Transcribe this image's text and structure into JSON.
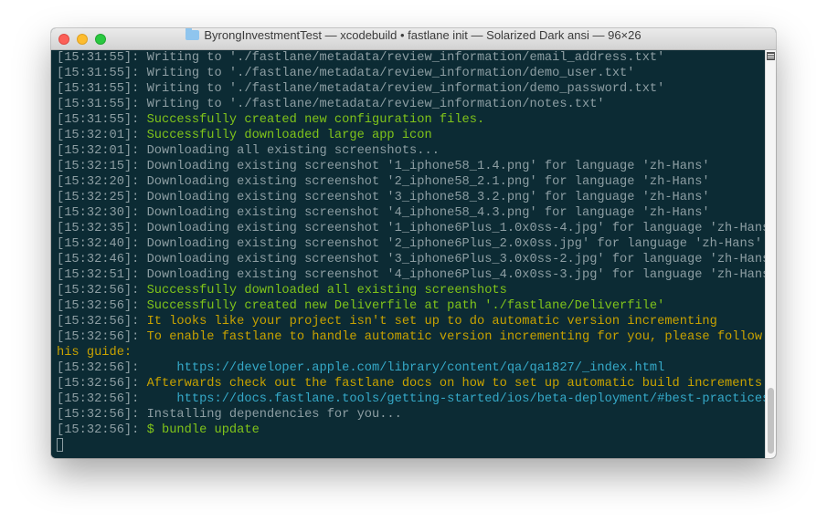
{
  "window": {
    "title": "ByrongInvestmentTest — xcodebuild • fastlane init — Solarized Dark ansi — 96×26",
    "folder_icon": "folder-icon"
  },
  "colors": {
    "background": "#0c2b34",
    "timestamp": "#8d9ea3",
    "green": "#80c41a",
    "yellow": "#c8a200",
    "cyan": "#35a9c8"
  },
  "terminal": {
    "lines": [
      {
        "ts": "[15:31:55]: ",
        "msg": "Writing to './fastlane/metadata/review_information/email_address.txt'",
        "color": "dim"
      },
      {
        "ts": "[15:31:55]: ",
        "msg": "Writing to './fastlane/metadata/review_information/demo_user.txt'",
        "color": "dim"
      },
      {
        "ts": "[15:31:55]: ",
        "msg": "Writing to './fastlane/metadata/review_information/demo_password.txt'",
        "color": "dim"
      },
      {
        "ts": "[15:31:55]: ",
        "msg": "Writing to './fastlane/metadata/review_information/notes.txt'",
        "color": "dim"
      },
      {
        "ts": "[15:31:55]: ",
        "msg": "Successfully created new configuration files.",
        "color": "green"
      },
      {
        "ts": "[15:32:01]: ",
        "msg": "Successfully downloaded large app icon",
        "color": "green"
      },
      {
        "ts": "[15:32:01]: ",
        "msg": "Downloading all existing screenshots...",
        "color": "dim"
      },
      {
        "ts": "[15:32:15]: ",
        "msg": "Downloading existing screenshot '1_iphone58_1.4.png' for language 'zh-Hans'",
        "color": "dim"
      },
      {
        "ts": "[15:32:20]: ",
        "msg": "Downloading existing screenshot '2_iphone58_2.1.png' for language 'zh-Hans'",
        "color": "dim"
      },
      {
        "ts": "[15:32:25]: ",
        "msg": "Downloading existing screenshot '3_iphone58_3.2.png' for language 'zh-Hans'",
        "color": "dim"
      },
      {
        "ts": "[15:32:30]: ",
        "msg": "Downloading existing screenshot '4_iphone58_4.3.png' for language 'zh-Hans'",
        "color": "dim"
      },
      {
        "ts": "[15:32:35]: ",
        "msg": "Downloading existing screenshot '1_iphone6Plus_1.0x0ss-4.jpg' for language 'zh-Hans'",
        "color": "dim"
      },
      {
        "ts": "[15:32:40]: ",
        "msg": "Downloading existing screenshot '2_iphone6Plus_2.0x0ss.jpg' for language 'zh-Hans'",
        "color": "dim"
      },
      {
        "ts": "[15:32:46]: ",
        "msg": "Downloading existing screenshot '3_iphone6Plus_3.0x0ss-2.jpg' for language 'zh-Hans'",
        "color": "dim"
      },
      {
        "ts": "[15:32:51]: ",
        "msg": "Downloading existing screenshot '4_iphone6Plus_4.0x0ss-3.jpg' for language 'zh-Hans'",
        "color": "dim"
      },
      {
        "ts": "[15:32:56]: ",
        "msg": "Successfully downloaded all existing screenshots",
        "color": "green"
      },
      {
        "ts": "[15:32:56]: ",
        "msg": "Successfully created new Deliverfile at path './fastlane/Deliverfile'",
        "color": "green"
      },
      {
        "ts": "[15:32:56]: ",
        "msg": "It looks like your project isn't set up to do automatic version incrementing",
        "color": "yellow"
      },
      {
        "ts": "[15:32:56]: ",
        "msg": "To enable fastlane to handle automatic version incrementing for you, please follow t",
        "color": "yellow"
      },
      {
        "ts": "",
        "msg": "his guide:",
        "color": "yellow"
      },
      {
        "ts": "[15:32:56]: ",
        "msg": "    https://developer.apple.com/library/content/qa/qa1827/_index.html",
        "color": "cyan"
      },
      {
        "ts": "[15:32:56]: ",
        "msg": "Afterwards check out the fastlane docs on how to set up automatic build increments",
        "color": "yellow"
      },
      {
        "ts": "[15:32:56]: ",
        "msg": "    https://docs.fastlane.tools/getting-started/ios/beta-deployment/#best-practices",
        "color": "cyan"
      },
      {
        "ts": "[15:32:56]: ",
        "msg": "Installing dependencies for you...",
        "color": "dim"
      },
      {
        "ts": "[15:32:56]: ",
        "msg": "$ bundle update",
        "color": "prompt"
      }
    ]
  },
  "scrollbar": {
    "menu_icon": "list-icon",
    "position": 0.96
  }
}
